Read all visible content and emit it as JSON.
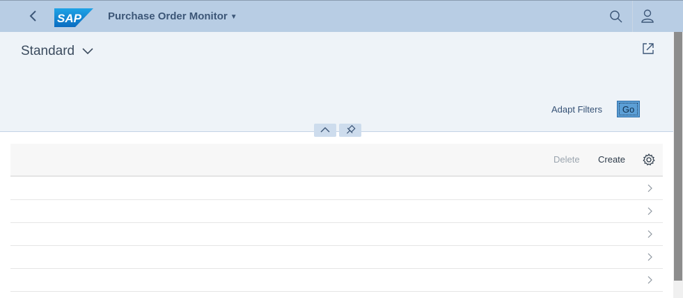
{
  "shell": {
    "logo_text": "SAP",
    "app_title": "Purchase Order Monitor",
    "icons": [
      "back-icon",
      "search-icon",
      "user-icon"
    ]
  },
  "filter": {
    "variant": "Standard",
    "adapt_filters": "Adapt Filters",
    "go": "Go",
    "icons": [
      "share-icon",
      "chevron-up-icon",
      "pin-icon"
    ]
  },
  "table": {
    "delete": "Delete",
    "create": "Create",
    "settings_icon": "gear-icon",
    "rows": [
      "",
      "",
      "",
      "",
      ""
    ]
  },
  "colors": {
    "shell": "#b8cde4",
    "filterbar": "#eef3f8",
    "accent": "#5c9fd6"
  }
}
